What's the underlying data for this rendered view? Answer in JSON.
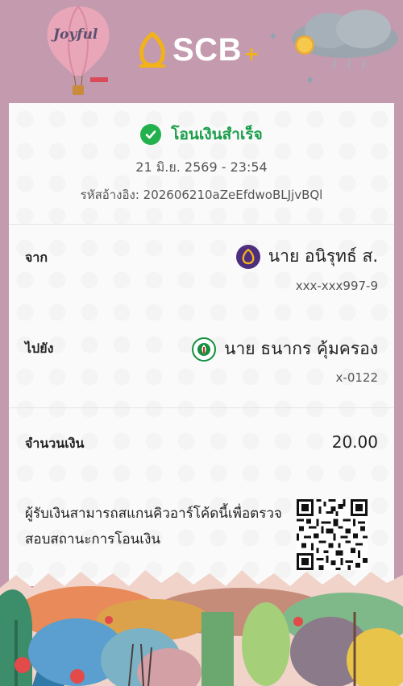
{
  "header": {
    "brand": "SCB",
    "brand_plus": "+",
    "balloon_text": "Joyful",
    "colors": {
      "background": "#c49aae",
      "brand_gold": "#f2b21a"
    }
  },
  "receipt": {
    "status_text": "โอนเงินสำเร็จ",
    "datetime": "21 มิ.ย. 2569 - 23:54",
    "reference": "รหัสอ้างอิง: 202606210aZeEfdwoBLJjvBQl",
    "from": {
      "label": "จาก",
      "name": "นาย อนิรุทธ์ ส.",
      "account": "xxx-xxx997-9",
      "bank_icon": "scb-bank-icon"
    },
    "to": {
      "label": "ไปยัง",
      "name": "นาย ธนากร คุ้มครอง",
      "account": "x-0122",
      "bank_icon": "kbank-icon"
    },
    "amount": {
      "label": "จำนวนเงิน",
      "value": "20.00"
    },
    "qr_message": "ผู้รับเงินสามารถสแกนคิวอาร์โค้ดนี้เพื่อตรวจสอบสถานะการโอนเงิน",
    "colors": {
      "success": "#22b14c",
      "success_text": "#1a9e4a"
    }
  }
}
